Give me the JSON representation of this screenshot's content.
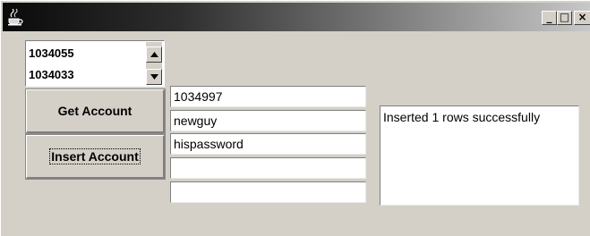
{
  "window": {
    "icon": "java-coffee-cup-icon",
    "controls": {
      "minimize": "_",
      "maximize": "□",
      "close": "×"
    }
  },
  "account_list": {
    "items": [
      "1034055",
      "1034033"
    ],
    "scroll_icons": [
      "scroll-up-arrow-icon",
      "scroll-down-arrow-icon"
    ]
  },
  "buttons": {
    "get_account": "Get Account",
    "insert_account": "Insert Account"
  },
  "fields": {
    "account_id": "1034997",
    "username": "newguy",
    "password": "hispassword",
    "field4": "",
    "field5": ""
  },
  "status_message": "Inserted 1 rows successfully"
}
